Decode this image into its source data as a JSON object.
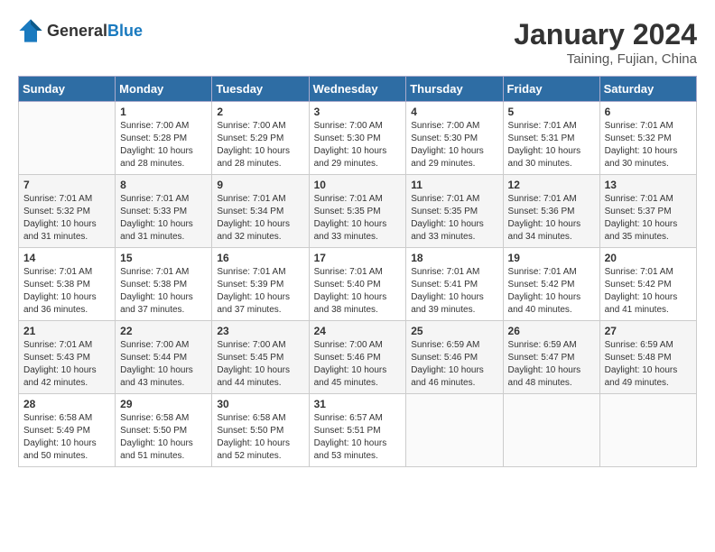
{
  "header": {
    "logo_general": "General",
    "logo_blue": "Blue",
    "title": "January 2024",
    "subtitle": "Taining, Fujian, China"
  },
  "calendar": {
    "days_of_week": [
      "Sunday",
      "Monday",
      "Tuesday",
      "Wednesday",
      "Thursday",
      "Friday",
      "Saturday"
    ],
    "weeks": [
      [
        {
          "day": "",
          "sunrise": "",
          "sunset": "",
          "daylight": ""
        },
        {
          "day": "1",
          "sunrise": "7:00 AM",
          "sunset": "5:28 PM",
          "daylight": "10 hours and 28 minutes."
        },
        {
          "day": "2",
          "sunrise": "7:00 AM",
          "sunset": "5:29 PM",
          "daylight": "10 hours and 28 minutes."
        },
        {
          "day": "3",
          "sunrise": "7:00 AM",
          "sunset": "5:30 PM",
          "daylight": "10 hours and 29 minutes."
        },
        {
          "day": "4",
          "sunrise": "7:00 AM",
          "sunset": "5:30 PM",
          "daylight": "10 hours and 29 minutes."
        },
        {
          "day": "5",
          "sunrise": "7:01 AM",
          "sunset": "5:31 PM",
          "daylight": "10 hours and 30 minutes."
        },
        {
          "day": "6",
          "sunrise": "7:01 AM",
          "sunset": "5:32 PM",
          "daylight": "10 hours and 30 minutes."
        }
      ],
      [
        {
          "day": "7",
          "sunrise": "7:01 AM",
          "sunset": "5:32 PM",
          "daylight": "10 hours and 31 minutes."
        },
        {
          "day": "8",
          "sunrise": "7:01 AM",
          "sunset": "5:33 PM",
          "daylight": "10 hours and 31 minutes."
        },
        {
          "day": "9",
          "sunrise": "7:01 AM",
          "sunset": "5:34 PM",
          "daylight": "10 hours and 32 minutes."
        },
        {
          "day": "10",
          "sunrise": "7:01 AM",
          "sunset": "5:35 PM",
          "daylight": "10 hours and 33 minutes."
        },
        {
          "day": "11",
          "sunrise": "7:01 AM",
          "sunset": "5:35 PM",
          "daylight": "10 hours and 33 minutes."
        },
        {
          "day": "12",
          "sunrise": "7:01 AM",
          "sunset": "5:36 PM",
          "daylight": "10 hours and 34 minutes."
        },
        {
          "day": "13",
          "sunrise": "7:01 AM",
          "sunset": "5:37 PM",
          "daylight": "10 hours and 35 minutes."
        }
      ],
      [
        {
          "day": "14",
          "sunrise": "7:01 AM",
          "sunset": "5:38 PM",
          "daylight": "10 hours and 36 minutes."
        },
        {
          "day": "15",
          "sunrise": "7:01 AM",
          "sunset": "5:38 PM",
          "daylight": "10 hours and 37 minutes."
        },
        {
          "day": "16",
          "sunrise": "7:01 AM",
          "sunset": "5:39 PM",
          "daylight": "10 hours and 37 minutes."
        },
        {
          "day": "17",
          "sunrise": "7:01 AM",
          "sunset": "5:40 PM",
          "daylight": "10 hours and 38 minutes."
        },
        {
          "day": "18",
          "sunrise": "7:01 AM",
          "sunset": "5:41 PM",
          "daylight": "10 hours and 39 minutes."
        },
        {
          "day": "19",
          "sunrise": "7:01 AM",
          "sunset": "5:42 PM",
          "daylight": "10 hours and 40 minutes."
        },
        {
          "day": "20",
          "sunrise": "7:01 AM",
          "sunset": "5:42 PM",
          "daylight": "10 hours and 41 minutes."
        }
      ],
      [
        {
          "day": "21",
          "sunrise": "7:01 AM",
          "sunset": "5:43 PM",
          "daylight": "10 hours and 42 minutes."
        },
        {
          "day": "22",
          "sunrise": "7:00 AM",
          "sunset": "5:44 PM",
          "daylight": "10 hours and 43 minutes."
        },
        {
          "day": "23",
          "sunrise": "7:00 AM",
          "sunset": "5:45 PM",
          "daylight": "10 hours and 44 minutes."
        },
        {
          "day": "24",
          "sunrise": "7:00 AM",
          "sunset": "5:46 PM",
          "daylight": "10 hours and 45 minutes."
        },
        {
          "day": "25",
          "sunrise": "6:59 AM",
          "sunset": "5:46 PM",
          "daylight": "10 hours and 46 minutes."
        },
        {
          "day": "26",
          "sunrise": "6:59 AM",
          "sunset": "5:47 PM",
          "daylight": "10 hours and 48 minutes."
        },
        {
          "day": "27",
          "sunrise": "6:59 AM",
          "sunset": "5:48 PM",
          "daylight": "10 hours and 49 minutes."
        }
      ],
      [
        {
          "day": "28",
          "sunrise": "6:58 AM",
          "sunset": "5:49 PM",
          "daylight": "10 hours and 50 minutes."
        },
        {
          "day": "29",
          "sunrise": "6:58 AM",
          "sunset": "5:50 PM",
          "daylight": "10 hours and 51 minutes."
        },
        {
          "day": "30",
          "sunrise": "6:58 AM",
          "sunset": "5:50 PM",
          "daylight": "10 hours and 52 minutes."
        },
        {
          "day": "31",
          "sunrise": "6:57 AM",
          "sunset": "5:51 PM",
          "daylight": "10 hours and 53 minutes."
        },
        {
          "day": "",
          "sunrise": "",
          "sunset": "",
          "daylight": ""
        },
        {
          "day": "",
          "sunrise": "",
          "sunset": "",
          "daylight": ""
        },
        {
          "day": "",
          "sunrise": "",
          "sunset": "",
          "daylight": ""
        }
      ]
    ]
  }
}
